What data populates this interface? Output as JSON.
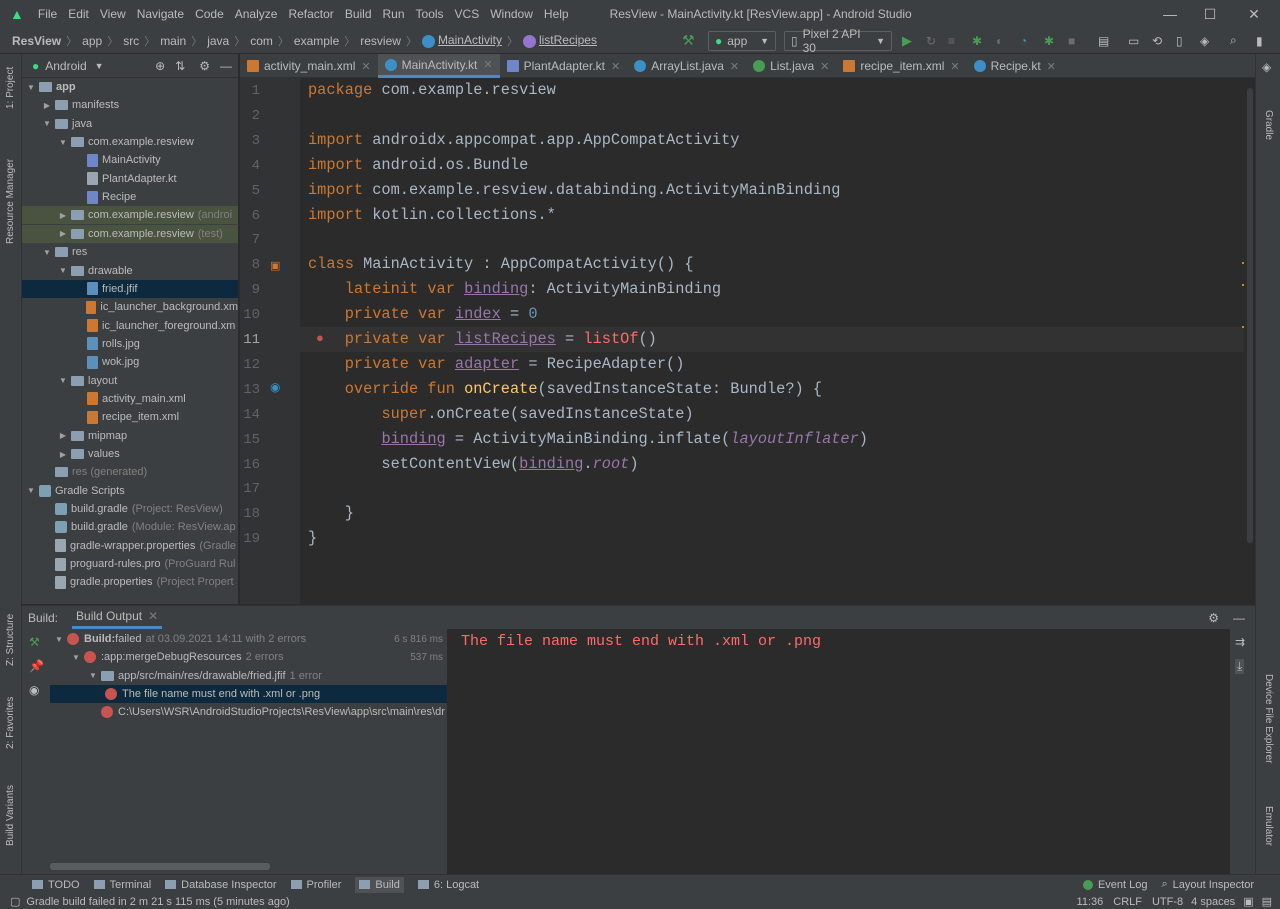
{
  "title_bar": {
    "menus": [
      "File",
      "Edit",
      "View",
      "Navigate",
      "Code",
      "Analyze",
      "Refactor",
      "Build",
      "Run",
      "Tools",
      "VCS",
      "Window",
      "Help"
    ],
    "window_title": "ResView - MainActivity.kt [ResView.app] - Android Studio"
  },
  "breadcrumbs": [
    "ResView",
    "app",
    "src",
    "main",
    "java",
    "com",
    "example",
    "resview",
    "MainActivity",
    "listRecipes"
  ],
  "toolbar": {
    "run_config": "app",
    "device": "Pixel 2 API 30"
  },
  "project_panel": {
    "view": "Android",
    "tree": [
      {
        "label": "app",
        "depth": 0,
        "kind": "folder",
        "open": true,
        "bold": true
      },
      {
        "label": "manifests",
        "depth": 1,
        "kind": "folder",
        "open": false
      },
      {
        "label": "java",
        "depth": 1,
        "kind": "folder",
        "open": true
      },
      {
        "label": "com.example.resview",
        "depth": 2,
        "kind": "folder",
        "open": true
      },
      {
        "label": "MainActivity",
        "depth": 3,
        "kind": "kt"
      },
      {
        "label": "PlantAdapter.kt",
        "depth": 3,
        "kind": "file"
      },
      {
        "label": "Recipe",
        "depth": 3,
        "kind": "kt"
      },
      {
        "label": "com.example.resview",
        "suffix": "(androi",
        "depth": 2,
        "kind": "folder",
        "open": false,
        "hl": true
      },
      {
        "label": "com.example.resview",
        "suffix": "(test)",
        "depth": 2,
        "kind": "folder",
        "open": false,
        "hl": true
      },
      {
        "label": "res",
        "depth": 1,
        "kind": "folder",
        "open": true
      },
      {
        "label": "drawable",
        "depth": 2,
        "kind": "folder",
        "open": true
      },
      {
        "label": "fried.jfif",
        "depth": 3,
        "kind": "img",
        "selected": true
      },
      {
        "label": "ic_launcher_background.xm",
        "depth": 3,
        "kind": "xml"
      },
      {
        "label": "ic_launcher_foreground.xm",
        "depth": 3,
        "kind": "xml"
      },
      {
        "label": "rolls.jpg",
        "depth": 3,
        "kind": "img"
      },
      {
        "label": "wok.jpg",
        "depth": 3,
        "kind": "img"
      },
      {
        "label": "layout",
        "depth": 2,
        "kind": "folder",
        "open": true
      },
      {
        "label": "activity_main.xml",
        "depth": 3,
        "kind": "xml"
      },
      {
        "label": "recipe_item.xml",
        "depth": 3,
        "kind": "xml"
      },
      {
        "label": "mipmap",
        "depth": 2,
        "kind": "folder",
        "open": false
      },
      {
        "label": "values",
        "depth": 2,
        "kind": "folder",
        "open": false
      },
      {
        "label": "res (generated)",
        "depth": 1,
        "kind": "folder",
        "muted": true
      },
      {
        "label": "Gradle Scripts",
        "depth": 0,
        "kind": "gradle",
        "open": true
      },
      {
        "label": "build.gradle",
        "suffix": "(Project: ResView)",
        "depth": 1,
        "kind": "gradle"
      },
      {
        "label": "build.gradle",
        "suffix": "(Module: ResView.ap",
        "depth": 1,
        "kind": "gradle"
      },
      {
        "label": "gradle-wrapper.properties",
        "suffix": "(Gradle",
        "depth": 1,
        "kind": "file"
      },
      {
        "label": "proguard-rules.pro",
        "suffix": "(ProGuard Rul",
        "depth": 1,
        "kind": "file"
      },
      {
        "label": "gradle.properties",
        "suffix": "(Project Propert",
        "depth": 1,
        "kind": "file"
      }
    ]
  },
  "editor_tabs": [
    {
      "label": "activity_main.xml",
      "icon": "xml"
    },
    {
      "label": "MainActivity.kt",
      "icon": "kt",
      "active": true
    },
    {
      "label": "PlantAdapter.kt",
      "icon": "file"
    },
    {
      "label": "ArrayList.java",
      "icon": "java"
    },
    {
      "label": "List.java",
      "icon": "iface"
    },
    {
      "label": "recipe_item.xml",
      "icon": "xml"
    },
    {
      "label": "Recipe.kt",
      "icon": "kt"
    }
  ],
  "code_lines": [
    "<span class=\"kw\">package</span> com.example.resview",
    "",
    "<span class=\"kw\">import</span> androidx.appcompat.app.AppCompatActivity",
    "<span class=\"kw\">import</span> android.os.Bundle",
    "<span class=\"kw\">import</span> com.example.resview.databinding.ActivityMainBinding",
    "<span class=\"kw\">import</span> kotlin.collections.*",
    "",
    "<span class=\"kw\">class</span> MainActivity : AppCompatActivity() {",
    "    <span class=\"kw\">lateinit var</span> <span class=\"prop\">binding</span>: ActivityMainBinding",
    "    <span class=\"kw\">private var</span> <span class=\"prop\">index</span> = <span class=\"num\">0</span>",
    "    <span class=\"kw\">private var</span> <span class=\"prop\">listRecipes</span> = <span class=\"err\">listOf</span>()",
    "    <span class=\"kw\">private var</span> <span class=\"prop\">adapter</span> = RecipeAdapter()",
    "    <span class=\"kw\">override fun</span> <span class=\"fn\">onCreate</span>(savedInstanceState: Bundle?) {",
    "        <span class=\"kw\">super</span>.onCreate(savedInstanceState)",
    "        <span class=\"prop\">binding</span> = ActivityMainBinding.inflate(<span class=\"propi\">layoutInflater</span>)",
    "        setContentView(<span class=\"prop\">binding</span>.<span class=\"propi\">root</span>)",
    "",
    "    }",
    "}"
  ],
  "line_numbers": [
    "1",
    "2",
    "3",
    "4",
    "5",
    "6",
    "7",
    "8",
    "9",
    "10",
    "11",
    "12",
    "13",
    "14",
    "15",
    "16",
    "17",
    "18",
    "19"
  ],
  "current_line": "11",
  "build_panel": {
    "label": "Build:",
    "tab": "Build Output",
    "rows": [
      {
        "depth": 0,
        "bold": "Build:",
        "text": " failed",
        "meta": " at 03.09.2021 14:11 with 2 errors",
        "time": "6 s 816 ms"
      },
      {
        "depth": 1,
        "text": ":app:mergeDebugResources",
        "meta": " 2 errors",
        "time": "537 ms"
      },
      {
        "depth": 2,
        "text": "app/src/main/res/drawable/fried.jfif",
        "meta": " 1 error",
        "folder": true
      },
      {
        "depth": 3,
        "text": "The file name must end with .xml or .png",
        "selected": true
      },
      {
        "depth": 2,
        "text": "C:\\Users\\WSR\\AndroidStudioProjects\\ResView\\app\\src\\main\\res\\dr"
      }
    ],
    "output": "The file name must end with .xml or .png"
  },
  "bottom_tools": [
    "TODO",
    "Terminal",
    "Database Inspector",
    "Profiler",
    "Build",
    "6: Logcat"
  ],
  "bottom_right_tools": [
    "Event Log",
    "Layout Inspector"
  ],
  "status": {
    "message": "Gradle build failed in 2 m 21 s 115 ms (5 minutes ago)",
    "position": "11:36",
    "line_sep": "CRLF",
    "encoding": "UTF-8",
    "indent": "4 spaces"
  },
  "side_labels": {
    "project": "1: Project",
    "resource": "Resource Manager",
    "structure": "Z: Structure",
    "favorites": "2: Favorites",
    "variants": "Build Variants",
    "gradle": "Gradle",
    "device_explorer": "Device File Explorer",
    "emulator": "Emulator"
  },
  "colors": {
    "keyword": "#cc7832",
    "function": "#ffc66d",
    "number": "#6897bb",
    "property": "#9876aa",
    "error": "#ff6b68",
    "selection": "#0d293e"
  }
}
